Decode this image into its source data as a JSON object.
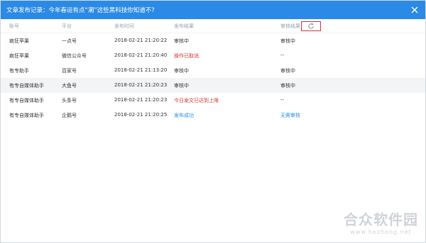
{
  "window": {
    "title": "文章发布记录：今年春运有点“潮”这些黑科技你知道不?"
  },
  "table": {
    "headers": {
      "account": "账号",
      "platform": "平台",
      "time": "发布时间",
      "result": "发布结果",
      "review": "审核结果"
    },
    "rows": [
      {
        "account": "疯狂苹果",
        "platform": "一点号",
        "time": "2018-02-21 21:20:22",
        "result": "审核中",
        "review": "审核中"
      },
      {
        "account": "疯狂苹果",
        "platform": "微信公众号",
        "time": "2018-02-21 21:20:40",
        "result": "操作已取消",
        "review": "--"
      },
      {
        "account": "有专助手",
        "platform": "百家号",
        "time": "2018-02-21 21:13:20",
        "result": "审核中",
        "review": "审核中"
      },
      {
        "account": "有专自媒体助手",
        "platform": "大鱼号",
        "time": "2018-02-21 21:20:23",
        "result": "审核中",
        "review": "审核中"
      },
      {
        "account": "有专自媒体助手",
        "platform": "头条号",
        "time": "2018-02-21 21:20:23",
        "result": "今日发文已达到上限",
        "review": "--"
      },
      {
        "account": "有专自媒体助手",
        "platform": "企鹅号",
        "time": "2018-02-21 21:20:25",
        "result": "发布成功",
        "review": "无需审核"
      }
    ]
  },
  "watermark": {
    "main": "合众软件园",
    "sub": "www.hezhong.net"
  },
  "colors": {
    "titlebar": "#2a8ae6",
    "error": "#e0322b",
    "link": "#2a8ae6",
    "highlight": "#e0322b"
  },
  "icons": {
    "close": "close-icon",
    "refresh": "refresh-icon"
  }
}
